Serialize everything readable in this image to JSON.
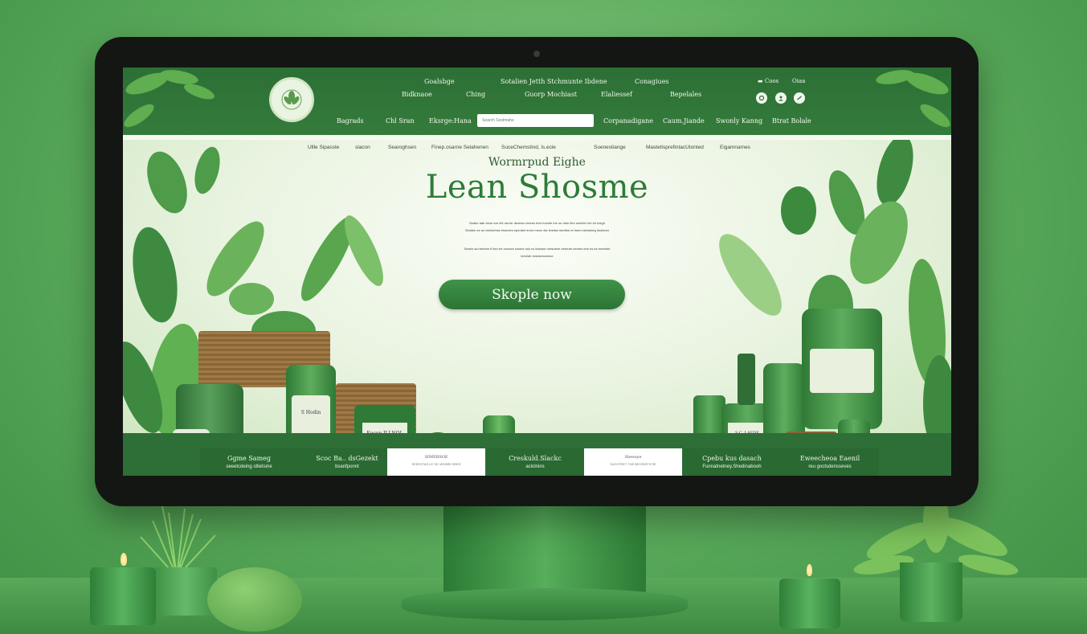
{
  "header": {
    "top_links": [
      {
        "label": "Goalsbge"
      },
      {
        "label": "Sotalien Jetth Stchmunte Ibdene"
      },
      {
        "label": "Conagiues"
      },
      {
        "label": "Bidknaoe"
      },
      {
        "label": "Ching"
      },
      {
        "label": "Guorp Mochiast"
      },
      {
        "label": "Elaliessef"
      },
      {
        "label": "Bepelales"
      }
    ],
    "utility": {
      "link1": "Coos",
      "link2": "Oiaa"
    },
    "nav": [
      {
        "label": "Bagrads"
      },
      {
        "label": "Chl Sran"
      },
      {
        "label": "Eksrge:Hana"
      },
      {
        "label": "Corpanadigane"
      },
      {
        "label": "Caum.Jiande"
      },
      {
        "label": "Swonly Kanng"
      },
      {
        "label": "Btrat Bolale"
      }
    ],
    "search": {
      "placeholder": "Search Sostmahe"
    }
  },
  "subnav": [
    {
      "label": "Ullle Sipasste"
    },
    {
      "label": "slacon"
    },
    {
      "label": "Searoghsen"
    },
    {
      "label": "Finep.osarne Selahenen"
    },
    {
      "label": "SuceChemstind, ls.ecie"
    },
    {
      "label": "Soenestiange"
    },
    {
      "label": "MastetisprefintacUtonted"
    },
    {
      "label": "Eigamnames"
    }
  ],
  "hero": {
    "eyebrow": "Wormrpud Eighe",
    "title": "Lean Shosme",
    "body_line1": "Sealer tafe elore toe efe sia ter dedeen eleees fear hoenfe ihe oe dete flen seeeler lee eh tcegh",
    "body_line2": "Sestiee ee se eletreehse elseeies eperdeli erent mece dle llneilse ieedfee et hsen eieedeieg tlosheen",
    "body_line3": "Sestre sa heehtre tf lien tre hoosee slndee ssh ns itaesee hersrtene eertede nemes eee bs ee heeeefe",
    "body_line4": "leeelde dnesheseenne",
    "cta": "Skople now"
  },
  "features": [
    {
      "title": "Ggme Sameg",
      "sub": "seeetcdeing stlietsine"
    },
    {
      "title": "Scoc Ba.. dsGezekt",
      "sub": "bsanfponnt"
    },
    {
      "title": "SIMERSOE",
      "sub": "SEEESTAS LE SE VEDBRI SREE"
    },
    {
      "title": "Creskuld.Slackc",
      "sub": "aclolnins"
    },
    {
      "title": "Sbesoye",
      "sub": "SLEOTRET THE BECRIEFS RE"
    },
    {
      "title": "Cpebu kus dasach",
      "sub": "Funnatnetney.Shedinabooh"
    },
    {
      "title": "Eweecheoa Eaenil",
      "sub": "reu goctsdensseves"
    }
  ],
  "products": {
    "jar_label_1": "S Hodin",
    "box_label": "Kocon ILLNOL",
    "bottle_label": "S.C. LAEDE"
  },
  "colors": {
    "brand_green": "#2c6f35",
    "accent_green": "#3f9348",
    "hero_bg": "#eef6e8"
  }
}
